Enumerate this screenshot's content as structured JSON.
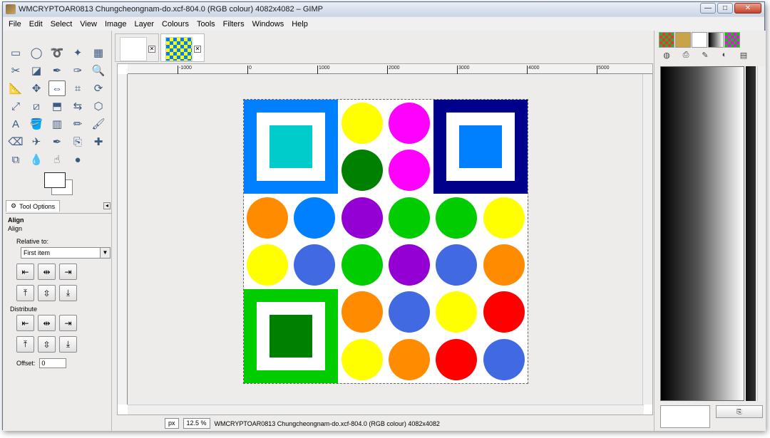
{
  "window": {
    "title": "WMCRYPTOAR0813 Chungcheongnam-do.xcf-804.0 (RGB colour) 4082x4082 – GIMP",
    "controls": {
      "minimize": "—",
      "maximize": "□",
      "close": "✕"
    }
  },
  "menu": [
    "File",
    "Edit",
    "Select",
    "View",
    "Image",
    "Layer",
    "Colours",
    "Tools",
    "Filters",
    "Windows",
    "Help"
  ],
  "toolbox": {
    "tools": [
      "rect-select",
      "ellipse-select",
      "free-select",
      "fuzzy-select",
      "select-by-color",
      "scissors",
      "foreground-select",
      "paths",
      "color-picker",
      "zoom",
      "measure",
      "move",
      "align",
      "crop",
      "rotate",
      "scale",
      "shear",
      "perspective",
      "flip",
      "cage",
      "text",
      "bucket-fill",
      "blend",
      "pencil",
      "paintbrush",
      "eraser",
      "airbrush",
      "ink",
      "clone",
      "heal",
      "perspective-clone",
      "blur",
      "smudge",
      "dodge-burn",
      ""
    ],
    "active_tool_index": 12
  },
  "tool_options": {
    "tab_label": "Tool Options",
    "title": "Align",
    "subtitle": "Align",
    "relative_label": "Relative to:",
    "relative_value": "First item",
    "distribute_label": "Distribute",
    "offset_label": "Offset:",
    "offset_value": "0",
    "align_buttons": [
      "⇤",
      "⇹",
      "⇥",
      "⤒",
      "⇳",
      "⤓"
    ],
    "distribute_buttons": [
      "⇤",
      "⇹",
      "⇥",
      "⤒",
      "⇳",
      "⤓"
    ]
  },
  "ruler": {
    "ticks": [
      "-1000",
      "0",
      "1000",
      "2000",
      "3000",
      "4000",
      "5000"
    ]
  },
  "image": {
    "colors": {
      "blue": "#0080ff",
      "cyan": "#00cccc",
      "navy": "#00008b",
      "green": "#00cc00",
      "darkgreen": "#008000",
      "yellow": "#ffff00",
      "magenta": "#ff00ff",
      "orange": "#ff8c00",
      "purple": "#9400d3",
      "royal": "#4169e1",
      "red": "#ff0000"
    },
    "frames": [
      {
        "name": "top-left-frame",
        "outer": "#0080ff",
        "core": "#00cccc"
      },
      {
        "name": "top-right-frame",
        "outer": "#00008b",
        "core": "#0080ff"
      },
      {
        "name": "bottom-left-frame",
        "outer": "#00cc00",
        "core": "#008000"
      }
    ],
    "dots": [
      [
        "",
        "",
        "#ffff00",
        "#ff00ff",
        "",
        ""
      ],
      [
        "",
        "",
        "#008000",
        "#ff00ff",
        "",
        ""
      ],
      [
        "#ff8c00",
        "#0080ff",
        "#9400d3",
        "#00cc00",
        "#00cc00",
        "#ffff00"
      ],
      [
        "#ffff00",
        "#4169e1",
        "#00cc00",
        "#9400d3",
        "#4169e1",
        "#ff8c00"
      ],
      [
        "",
        "",
        "#ff8c00",
        "#4169e1",
        "#ffff00",
        "#ff0000"
      ],
      [
        "",
        "",
        "#ffff00",
        "#ff8c00",
        "#ff0000",
        "#4169e1"
      ]
    ]
  },
  "status": {
    "unit": "px",
    "zoom": "12.5 %",
    "text": "WMCRYPTOAR0813 Chungcheongnam-do.xcf-804.0 (RGB colour) 4082x4082"
  },
  "dock": {
    "button_label": "⎘"
  }
}
